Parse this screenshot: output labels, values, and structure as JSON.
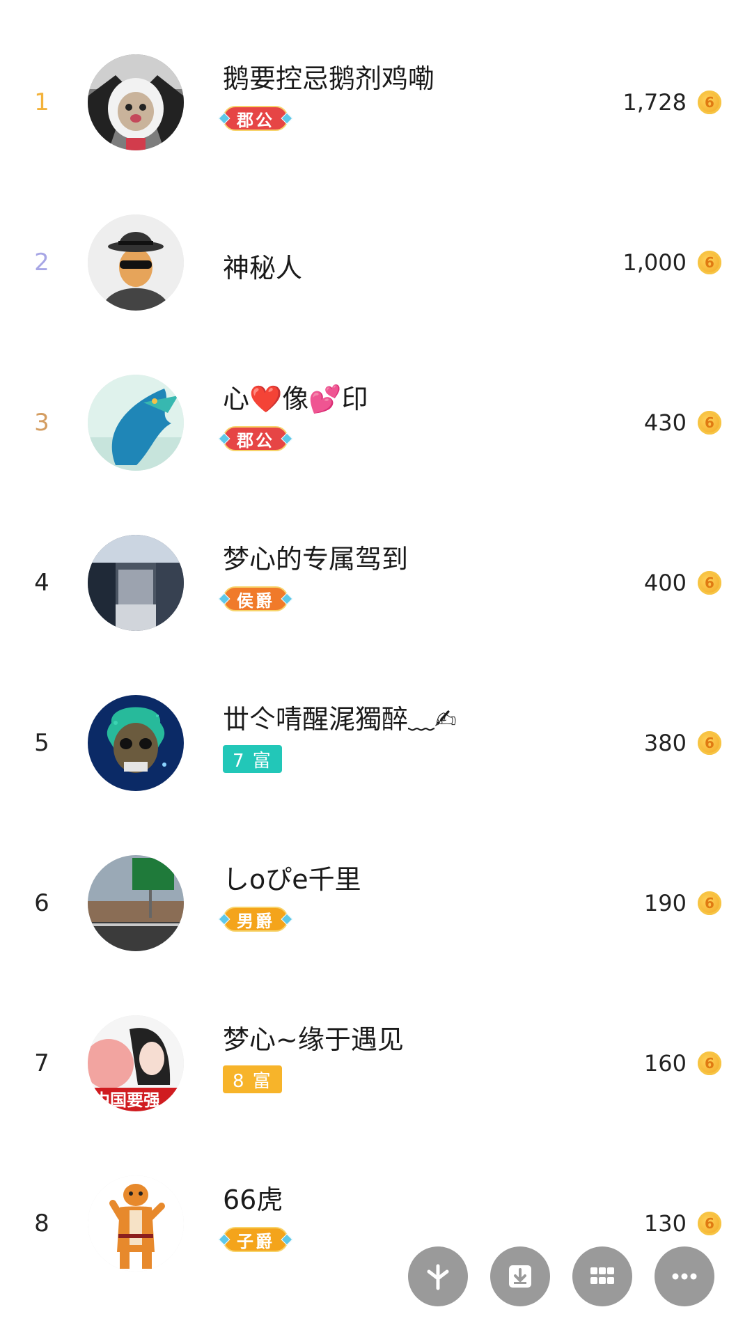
{
  "leaderboard": [
    {
      "rank": "1",
      "name": "鹅要控忌鹅剂鸡嘞",
      "badge_text": "郡公",
      "badge_kind": "title",
      "badge_color": "#e64545",
      "amount": "1,728",
      "rank_color": "#f3b23a",
      "avatar": "cat-hoodie-avatar"
    },
    {
      "rank": "2",
      "name": "神秘人",
      "badge_text": "",
      "badge_kind": "none",
      "badge_color": "",
      "amount": "1,000",
      "rank_color": "#a7a6e5",
      "avatar": "mystery-man-avatar"
    },
    {
      "rank": "3",
      "name": "心❤️像💕印",
      "badge_text": "郡公",
      "badge_kind": "title",
      "badge_color": "#e64545",
      "amount": "430",
      "rank_color": "#d49d61",
      "avatar": "blue-dragon-avatar"
    },
    {
      "rank": "4",
      "name": "梦心的专属驾到",
      "badge_text": "侯爵",
      "badge_kind": "title",
      "badge_color": "#f07a2a",
      "amount": "400",
      "rank_color": "#222222",
      "avatar": "mall-avatar"
    },
    {
      "rank": "5",
      "name": "丗仒啨醒浘獨醉﹏✍",
      "badge_text": "7 富",
      "badge_kind": "level",
      "badge_color": "#22c7b8",
      "amount": "380",
      "rank_color": "#222222",
      "avatar": "skull-avatar"
    },
    {
      "rank": "6",
      "name": "しoぴe千里",
      "badge_text": "男爵",
      "badge_kind": "title",
      "badge_color": "#f4a41b",
      "amount": "190",
      "rank_color": "#222222",
      "avatar": "highway-avatar"
    },
    {
      "rank": "7",
      "name": "梦心~缘于遇见",
      "badge_text": "8 富",
      "badge_kind": "level",
      "badge_color": "#f7b42a",
      "amount": "160",
      "rank_color": "#222222",
      "avatar": "woman-avatar"
    },
    {
      "rank": "8",
      "name": "66虎",
      "badge_text": "子爵",
      "badge_kind": "title",
      "badge_color": "#f4a41b",
      "amount": "130",
      "rank_color": "#222222",
      "avatar": "tiger-avatar"
    }
  ],
  "coin_glyph": "6",
  "fab_icons": [
    "clover-icon",
    "download-icon",
    "grid-icon",
    "more-icon"
  ]
}
